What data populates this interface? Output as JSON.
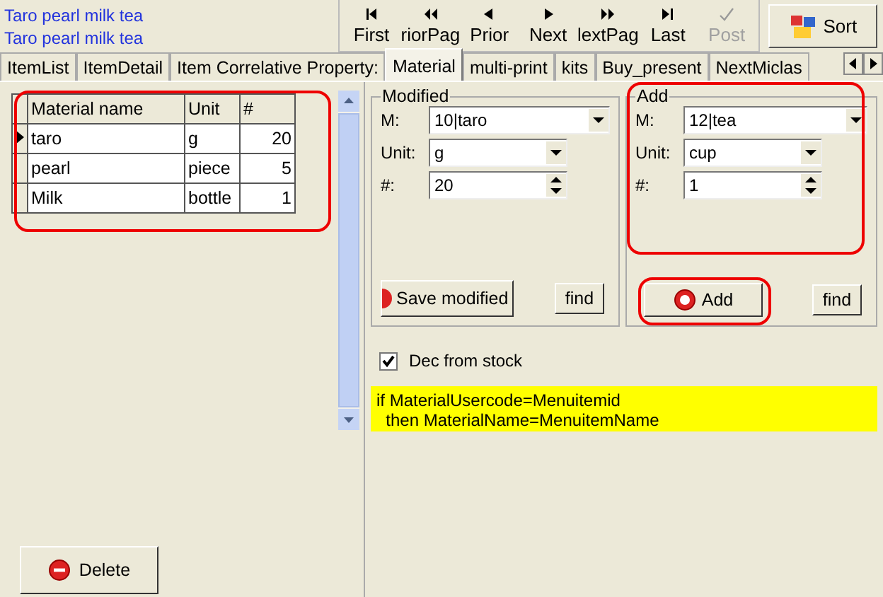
{
  "header": {
    "titles": [
      "Taro pearl milk tea",
      "Taro pearl milk tea"
    ]
  },
  "navigator": [
    {
      "kind": "first",
      "label": "First",
      "disabled": false
    },
    {
      "kind": "prior_page",
      "label": "riorPag",
      "disabled": false
    },
    {
      "kind": "prior",
      "label": "Prior",
      "disabled": false
    },
    {
      "kind": "next",
      "label": "Next",
      "disabled": false
    },
    {
      "kind": "next_page",
      "label": "lextPag",
      "disabled": false
    },
    {
      "kind": "last",
      "label": "Last",
      "disabled": false
    },
    {
      "kind": "post",
      "label": "Post",
      "disabled": true
    }
  ],
  "sort_button": "Sort",
  "tabs": [
    {
      "label": "ItemList",
      "selected": false
    },
    {
      "label": "ItemDetail",
      "selected": false
    },
    {
      "label": "Item Correlative Property:",
      "selected": false
    },
    {
      "label": "Material",
      "selected": true
    },
    {
      "label": "multi-print",
      "selected": false
    },
    {
      "label": "kits",
      "selected": false
    },
    {
      "label": "Buy_present",
      "selected": false
    },
    {
      "label": "NextMiclas",
      "selected": false
    }
  ],
  "table": {
    "columns": [
      "Material name",
      "Unit",
      "#"
    ],
    "rows": [
      {
        "cells": [
          "taro",
          "g",
          "20"
        ],
        "selected": true
      },
      {
        "cells": [
          "pearl",
          "piece",
          "5"
        ],
        "selected": false
      },
      {
        "cells": [
          "Milk",
          "bottle",
          "1"
        ],
        "selected": false
      }
    ]
  },
  "delete_button": "Delete",
  "modified": {
    "title": "Modified",
    "fields": [
      {
        "label": "M:",
        "value": "10|taro",
        "kind": "combo_wide"
      },
      {
        "label": "Unit:",
        "value": "g",
        "kind": "combo"
      },
      {
        "label": "#:",
        "value": "20",
        "kind": "spin"
      }
    ],
    "save_button": "Save modified",
    "find_button": "find"
  },
  "add": {
    "title": "Add",
    "fields": [
      {
        "label": "M:",
        "value": "12|tea",
        "kind": "combo_wide"
      },
      {
        "label": "Unit:",
        "value": "cup",
        "kind": "combo"
      },
      {
        "label": "#:",
        "value": "1",
        "kind": "spin"
      }
    ],
    "add_button": "Add",
    "find_button": "find"
  },
  "dec_from_stock": {
    "label": "Dec from stock",
    "checked": true
  },
  "note": [
    "if MaterialUsercode=Menuitemid",
    "  then MaterialName=MenuitemName"
  ]
}
